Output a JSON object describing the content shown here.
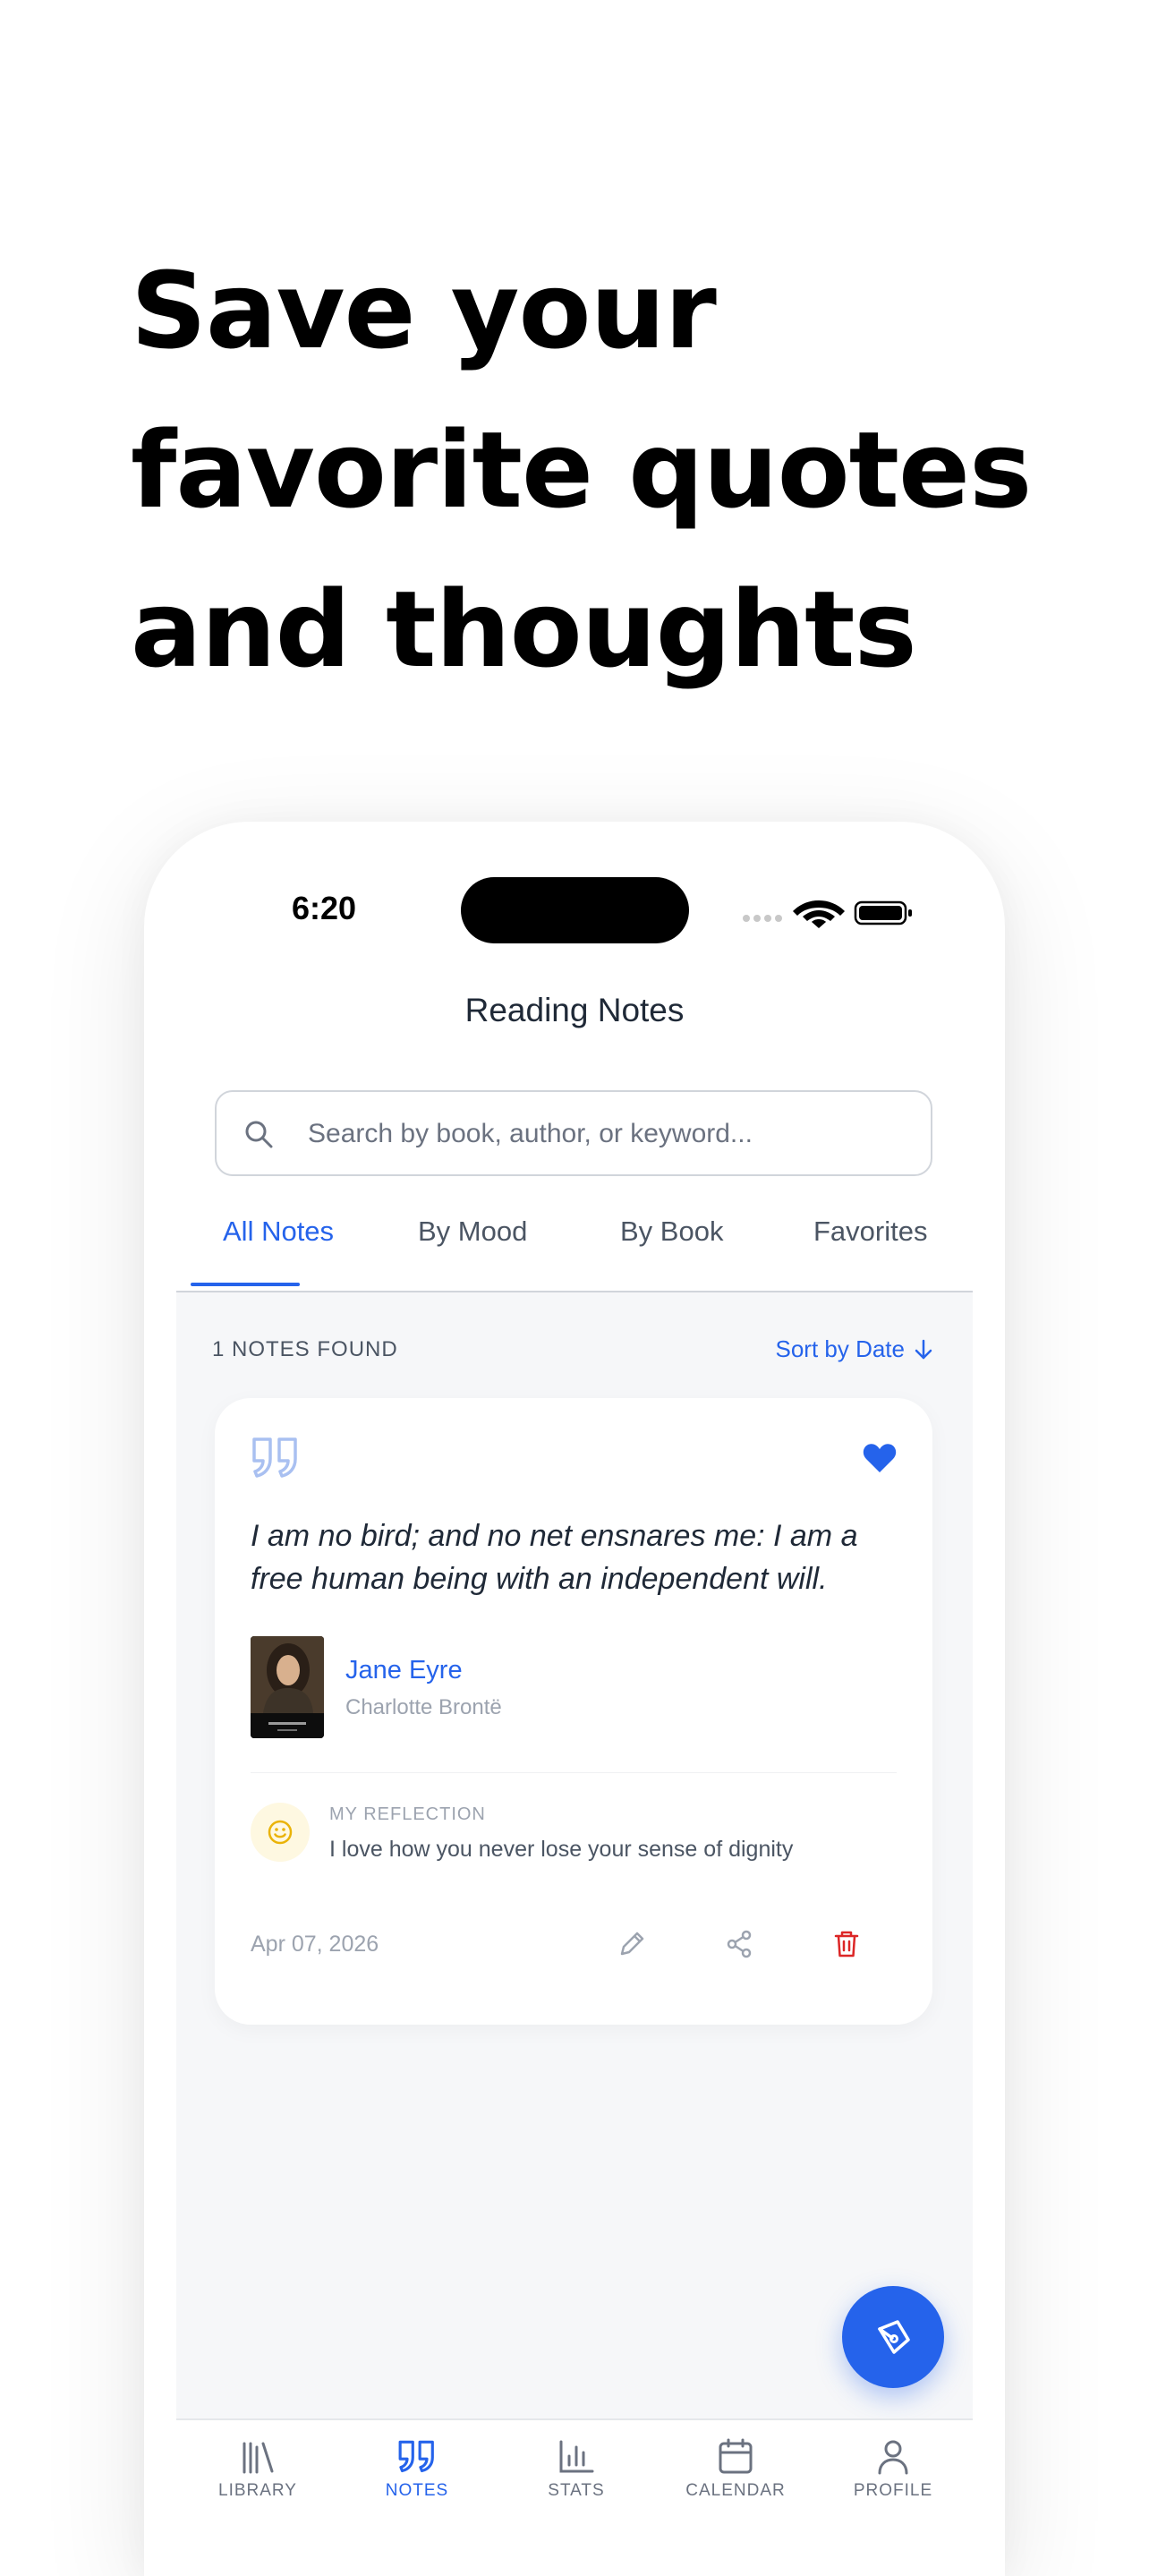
{
  "headline": {
    "line1": "Save your",
    "line2": "favorite quotes",
    "line3": "and thoughts"
  },
  "status_bar": {
    "time": "6:20"
  },
  "header": {
    "title": "Reading Notes"
  },
  "search": {
    "placeholder": "Search by book, author, or keyword...",
    "value": ""
  },
  "tabs": [
    {
      "label": "All Notes",
      "active": true
    },
    {
      "label": "By Mood",
      "active": false
    },
    {
      "label": "By Book",
      "active": false
    },
    {
      "label": "Favorites",
      "active": false
    }
  ],
  "list": {
    "count_label": "1 NOTES FOUND",
    "sort_label": "Sort by Date"
  },
  "notes": [
    {
      "quote": "I am no bird; and no net ensnares me: I am a free human being with an independent will.",
      "favorite": true,
      "book_title": "Jane Eyre",
      "book_author": "Charlotte Brontë",
      "reflection_label": "MY REFLECTION",
      "reflection": "I love how you never lose your sense of dignity",
      "mood_icon": "smile-icon",
      "date": "Apr 07, 2026"
    }
  ],
  "bottom_nav": [
    {
      "label": "LIBRARY",
      "icon": "library-icon"
    },
    {
      "label": "NOTES",
      "icon": "quote-icon",
      "active": true
    },
    {
      "label": "STATS",
      "icon": "bar-chart-icon"
    },
    {
      "label": "CALENDAR",
      "icon": "calendar-icon"
    },
    {
      "label": "PROFILE",
      "icon": "user-icon"
    }
  ],
  "colors": {
    "accent": "#2563eb",
    "delete": "#dc2626",
    "mood": "#eab308",
    "background": "#f6f7f9"
  }
}
